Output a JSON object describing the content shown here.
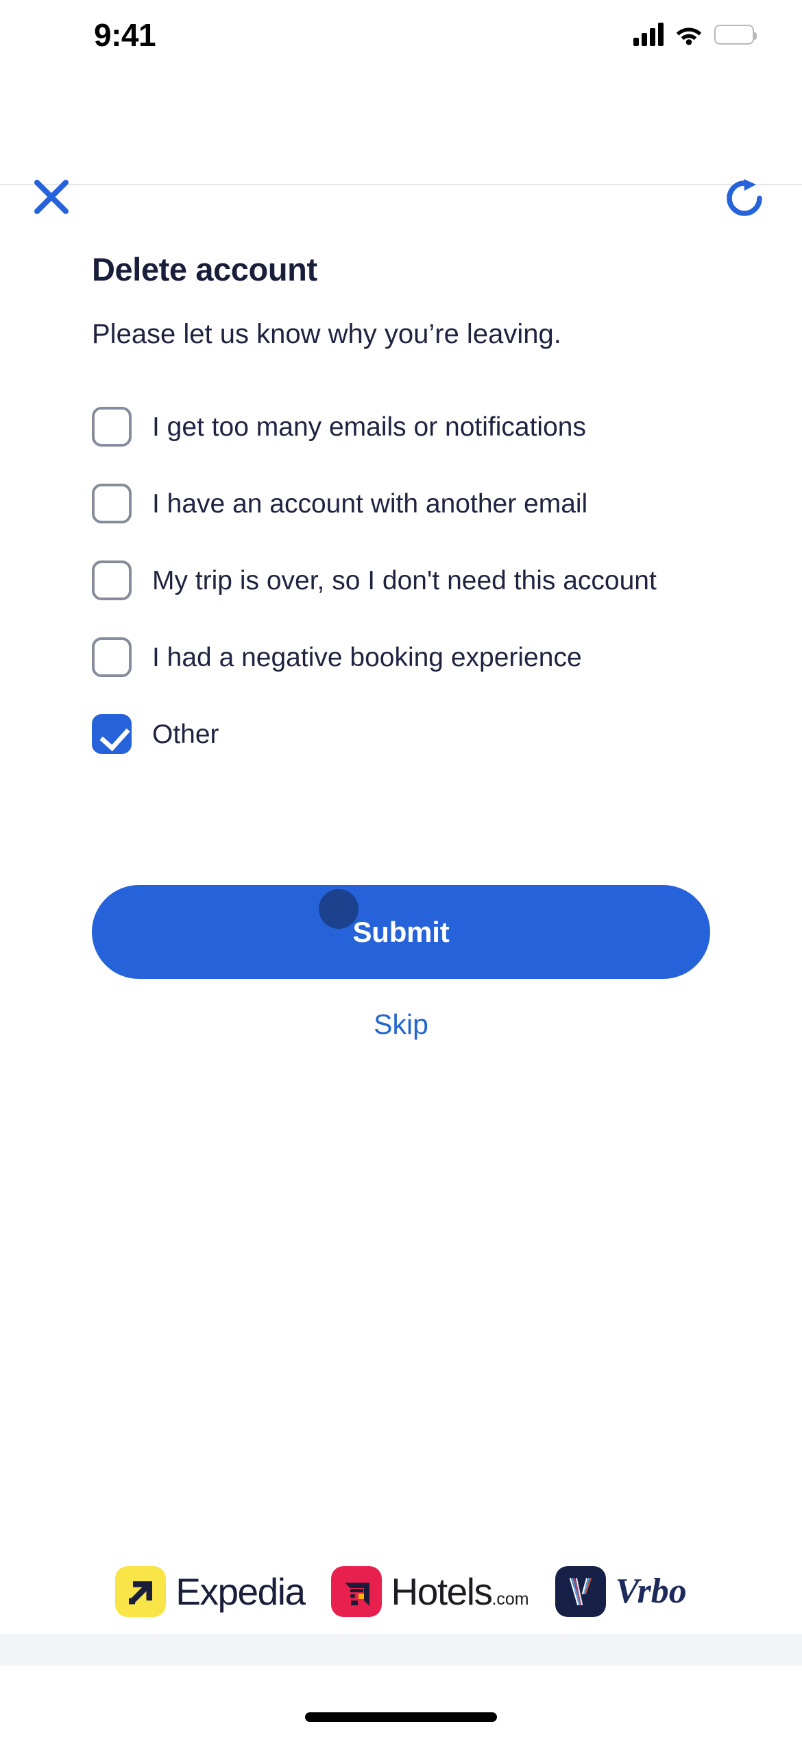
{
  "status_bar": {
    "time": "9:41",
    "cellular_icon": "cellular-signal-icon",
    "wifi_icon": "wifi-icon",
    "battery_icon": "battery-icon"
  },
  "nav_bar": {
    "close_icon": "close-icon",
    "refresh_icon": "refresh-icon"
  },
  "main": {
    "title": "Delete account",
    "subtitle": "Please let us know why you’re leaving.",
    "options": [
      {
        "label": "I get too many emails or notifications",
        "checked": false
      },
      {
        "label": "I have an account with another email",
        "checked": false
      },
      {
        "label": "My trip is over, so I don't need this account",
        "checked": false
      },
      {
        "label": "I had a negative booking experience",
        "checked": false
      },
      {
        "label": "Other",
        "checked": true
      }
    ],
    "submit_label": "Submit",
    "skip_label": "Skip",
    "tap_indicator": "tap-indicator"
  },
  "footer": {
    "brands": [
      {
        "name": "Expedia",
        "word": "Expedia",
        "icon": "expedia-logo-icon"
      },
      {
        "name": "Hotels.com",
        "word": "Hotels",
        "suffix": ".com",
        "icon": "hotels-logo-icon"
      },
      {
        "name": "Vrbo",
        "word": "Vrbo",
        "icon": "vrbo-logo-icon"
      }
    ]
  },
  "colors": {
    "accent_blue": "#2662d9",
    "link_blue": "#2566cc",
    "text_navy": "#1f2340",
    "checkbox_border": "#868c9b",
    "expedia_yellow": "#f9e547",
    "hotels_red": "#e8204d",
    "vrbo_navy": "#1d2b5c",
    "bottom_strip": "#f2f4f8"
  }
}
